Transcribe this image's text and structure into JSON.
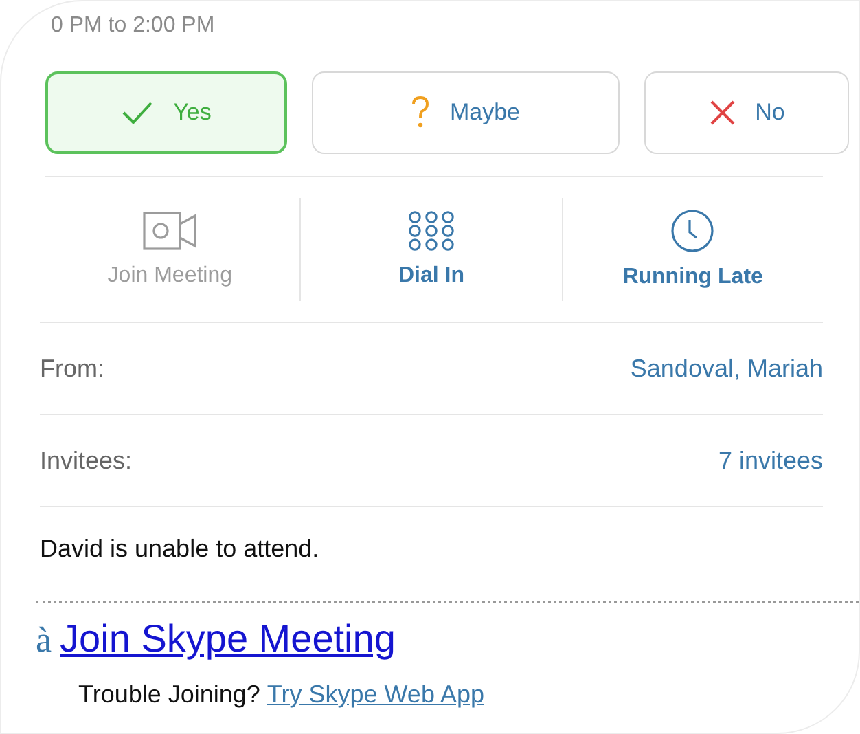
{
  "time": "0 PM to 2:00 PM",
  "responses": [
    {
      "kind": "yes",
      "label": "Yes",
      "selected": true
    },
    {
      "kind": "maybe",
      "label": "Maybe",
      "selected": false
    },
    {
      "kind": "no",
      "label": "No",
      "selected": false
    }
  ],
  "actions": [
    {
      "kind": "video",
      "label": "Join Meeting",
      "disabled": true
    },
    {
      "kind": "dialpad",
      "label": "Dial In",
      "disabled": false
    },
    {
      "kind": "clock",
      "label": "Running Late",
      "disabled": false
    }
  ],
  "details": [
    {
      "label": "From:",
      "value": "Sandoval, Mariah"
    },
    {
      "label": "Invitees:",
      "value": "7 invitees"
    }
  ],
  "note": "David is unable to attend.",
  "skype": {
    "bullet": "à",
    "link": "Join Skype Meeting",
    "trouble": "Trouble Joining?",
    "web_link": "Try Skype Web App"
  }
}
